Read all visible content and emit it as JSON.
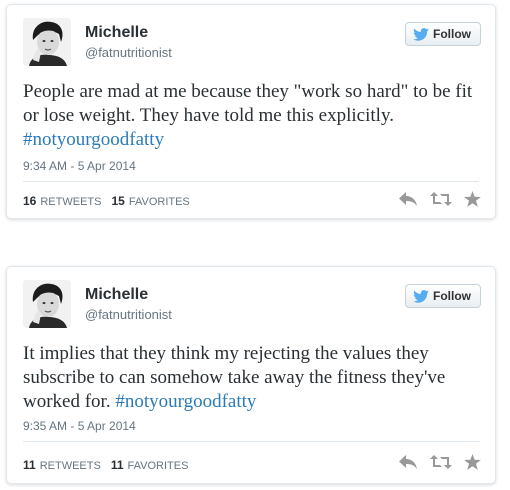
{
  "tweets": [
    {
      "author": {
        "name": "Michelle",
        "handle": "@fatnutritionist"
      },
      "follow_label": "Follow",
      "text": "People are mad at me because they \"work so hard\" to be fit or lose weight. They have told me this explicitly.",
      "hashtag": "#notyourgoodfatty",
      "timestamp": "9:34 AM - 5 Apr 2014",
      "retweets": {
        "count": "16",
        "label": "RETWEETS"
      },
      "favorites": {
        "count": "15",
        "label": "FAVORITES"
      }
    },
    {
      "author": {
        "name": "Michelle",
        "handle": "@fatnutritionist"
      },
      "follow_label": "Follow",
      "text": "It implies that they think my rejecting the values they subscribe to can somehow take away the fitness they've worked for.",
      "hashtag": "#notyourgoodfatty",
      "timestamp": "9:35 AM - 5 Apr 2014",
      "retweets": {
        "count": "11",
        "label": "RETWEETS"
      },
      "favorites": {
        "count": "11",
        "label": "FAVORITES"
      }
    }
  ],
  "icons": {
    "follow": "twitter-bird-icon",
    "reply": "reply-icon",
    "retweet": "retweet-icon",
    "favorite": "star-icon"
  },
  "colors": {
    "hashtag": "#2b7bb9",
    "bird": "#55acee",
    "action_icons": "#999999",
    "card_border": "#e1e8ed"
  }
}
